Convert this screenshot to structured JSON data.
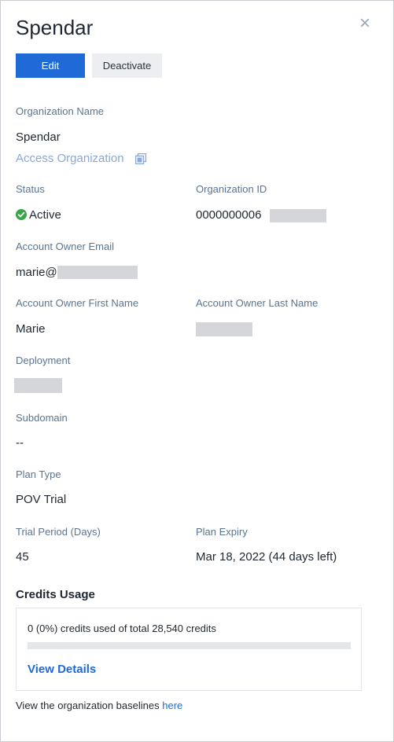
{
  "header": {
    "title": "Spendar",
    "close_glyph": "×"
  },
  "actions": {
    "edit_label": "Edit",
    "deactivate_label": "Deactivate"
  },
  "org_name": {
    "label": "Organization Name",
    "value": "Spendar",
    "access_link": "Access Organization",
    "access_icon": "external-link-icon"
  },
  "status": {
    "label": "Status",
    "value": "Active",
    "icon": "check-circle-icon",
    "color": "#3aa548"
  },
  "org_id": {
    "label": "Organization ID",
    "value_visible": "0000000006"
  },
  "owner_email": {
    "label": "Account Owner Email",
    "value_visible": "marie@"
  },
  "owner_first": {
    "label": "Account Owner First Name",
    "value": "Marie"
  },
  "owner_last": {
    "label": "Account Owner Last Name"
  },
  "deployment": {
    "label": "Deployment"
  },
  "subdomain": {
    "label": "Subdomain",
    "value": "--"
  },
  "plan_type": {
    "label": "Plan Type",
    "value": "POV Trial"
  },
  "trial_period": {
    "label": "Trial Period (Days)",
    "value": "45"
  },
  "plan_expiry": {
    "label": "Plan Expiry",
    "value": "Mar 18, 2022 (44 days left)"
  },
  "credits": {
    "title": "Credits Usage",
    "summary": "0 (0%) credits used of total 28,540 credits",
    "used_fraction": 0,
    "view_details": "View Details"
  },
  "baseline": {
    "text": "View the organization baselines",
    "link": "here"
  },
  "colors": {
    "primary": "#1f6ad6",
    "label": "#5a7491",
    "redaction": "#d4d6d9"
  }
}
